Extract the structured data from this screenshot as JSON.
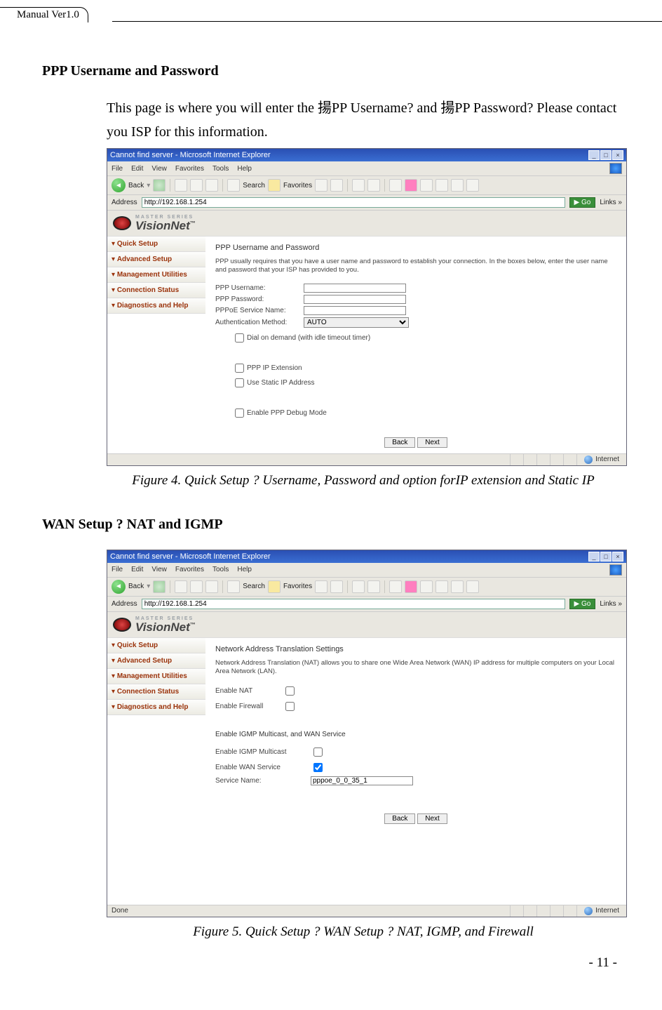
{
  "header": {
    "tab_label": "Manual Ver1.0"
  },
  "section1": {
    "heading": "PPP Username and Password",
    "body": "This page is where you will enter the 揚PP Username?  and 揚PP Password? Please contact you ISP for this information.",
    "caption": "Figure 4. Quick Setup ? Username, Password and option forIP extension and Static IP"
  },
  "section2": {
    "heading": "WAN Setup ? NAT and IGMP",
    "caption": "Figure 5. Quick Setup ? WAN Setup ? NAT, IGMP, and Firewall"
  },
  "ie_common": {
    "title": "Cannot find server - Microsoft Internet Explorer",
    "menu": [
      "File",
      "Edit",
      "View",
      "Favorites",
      "Tools",
      "Help"
    ],
    "toolbar": {
      "back": "Back",
      "search": "Search",
      "favorites": "Favorites"
    },
    "address_label": "Address",
    "address_value": "http://192.168.1.254",
    "go_label": "Go",
    "links_label": "Links »",
    "brand_series": "MASTER SERIES",
    "brand_name": "VisionNet",
    "sidebar": [
      "Quick Setup",
      "Advanced Setup",
      "Management Utilities",
      "Connection Status",
      "Diagnostics and Help"
    ],
    "status_done": "Done",
    "status_zone": "Internet",
    "btn_back": "Back",
    "btn_next": "Next"
  },
  "shot1": {
    "title": "PPP Username and Password",
    "desc": "PPP usually requires that you have a user name and password to establish your connection. In the boxes below, enter the user name and password that your ISP has provided to you.",
    "lbl_user": "PPP Username:",
    "lbl_pass": "PPP Password:",
    "lbl_svc": "PPPoE Service Name:",
    "lbl_auth": "Authentication Method:",
    "auth_val": "AUTO",
    "chk_dod": "Dial on demand (with idle timeout timer)",
    "chk_ext": "PPP IP Extension",
    "chk_static": "Use Static IP Address",
    "chk_debug": "Enable PPP Debug Mode"
  },
  "shot2": {
    "title": "Network Address Translation Settings",
    "desc": "Network Address Translation (NAT) allows you to share one Wide Area Network (WAN) IP address for multiple computers on your Local Area Network (LAN).",
    "lbl_nat": "Enable NAT",
    "lbl_fw": "Enable Firewall",
    "igmp_heading": "Enable IGMP Multicast, and WAN Service",
    "lbl_igmp": "Enable IGMP Multicast",
    "lbl_wan": "Enable WAN Service",
    "lbl_svcname": "Service Name:",
    "svc_val": "pppoe_0_0_35_1"
  },
  "page_number": "- 11 -"
}
